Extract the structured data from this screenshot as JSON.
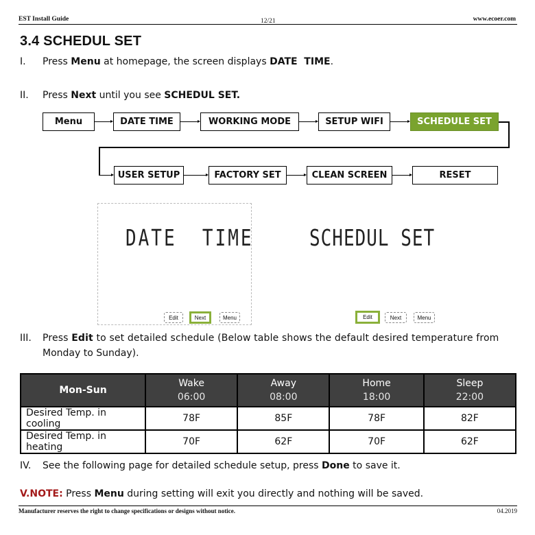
{
  "header": {
    "doc_title": "EST Install Guide",
    "page": "12/21",
    "website": "www.ecoer.com"
  },
  "section_title": "3.4 SCHEDUL SET",
  "steps": {
    "s1": {
      "num": "I.",
      "pre": "Press ",
      "bold1": "Menu",
      "mid": " at homepage, the screen displays ",
      "bold2": "DATE  TIME",
      "post": "."
    },
    "s2": {
      "num": "II.",
      "pre": "Press ",
      "bold1": "Next",
      "mid": " until you see ",
      "bold2": "SCHEDUL SET."
    },
    "s3": {
      "num": "III.",
      "pre": "Press ",
      "bold1": "Edit",
      "post": " to set detailed schedule (Below table shows the default desired temperature from",
      "line2": "Monday to Sunday)."
    },
    "s4": {
      "num": "IV.",
      "pre": "See the following page for detailed schedule setup, press ",
      "bold1": "Done",
      "post": " to save it."
    },
    "s5": {
      "label": "V.NOTE:",
      "pre": " Press ",
      "bold1": "Menu",
      "post": " during setting will exit you directly and nothing will be saved."
    }
  },
  "flowchart": {
    "row1": [
      "Menu",
      "DATE TIME",
      "WORKING MODE",
      "SETUP WIFI",
      "SCHEDULE SET"
    ],
    "row2": [
      "USER SETUP",
      "FACTORY SET",
      "CLEAN SCREEN",
      "RESET"
    ],
    "active": "SCHEDULE SET",
    "active_color": "#7aa32e"
  },
  "screens": [
    {
      "display": "DATE  TIME",
      "buttons": [
        "Edit",
        "Next",
        "Menu"
      ],
      "selected": "Next"
    },
    {
      "display": "SCHEDUL SET",
      "buttons": [
        "Edit",
        "Next",
        "Menu"
      ],
      "selected": "Edit"
    }
  ],
  "schedule_table": {
    "corner": "Mon-Sun",
    "columns": [
      {
        "name": "Wake",
        "time": "06:00"
      },
      {
        "name": "Away",
        "time": "08:00"
      },
      {
        "name": "Home",
        "time": "18:00"
      },
      {
        "name": "Sleep",
        "time": "22:00"
      }
    ],
    "rows": [
      {
        "label": "Desired Temp. in cooling",
        "values": [
          "78F",
          "85F",
          "78F",
          "82F"
        ]
      },
      {
        "label": "Desired Temp. in heating",
        "values": [
          "70F",
          "62F",
          "70F",
          "62F"
        ]
      }
    ]
  },
  "footer": {
    "disclaimer": "Manufacturer reserves the right to change specifications or designs without notice.",
    "date": "04.2019"
  },
  "colors": {
    "note_red": "#a31a1a",
    "table_header_bg": "#404040",
    "accent_green": "#7aa32e"
  }
}
